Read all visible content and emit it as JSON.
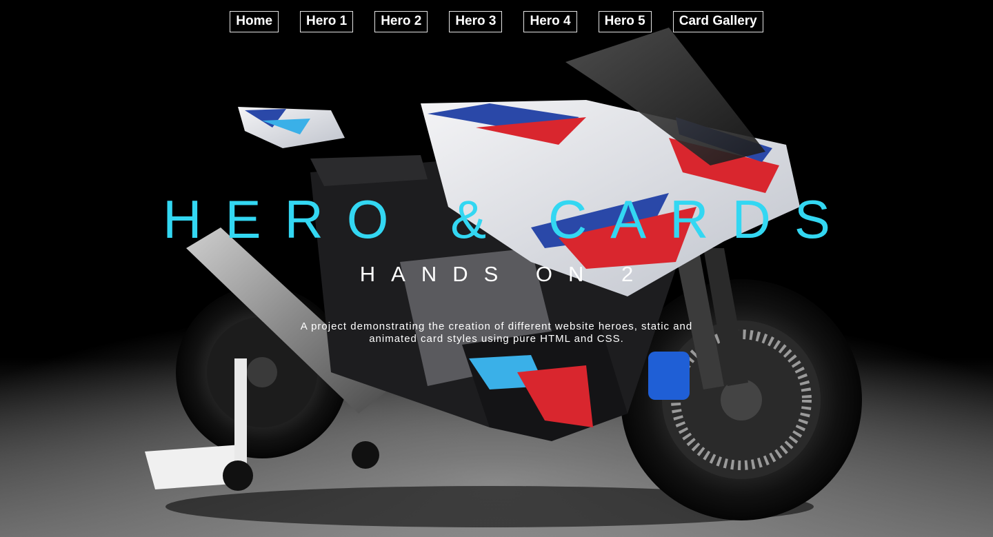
{
  "nav": {
    "items": [
      {
        "label": "Home"
      },
      {
        "label": "Hero 1"
      },
      {
        "label": "Hero 2"
      },
      {
        "label": "Hero 3"
      },
      {
        "label": "Hero 4"
      },
      {
        "label": "Hero 5"
      },
      {
        "label": "Card Gallery"
      }
    ]
  },
  "hero": {
    "title": "HERO & CARDS",
    "subtitle": "HANDS ON 2",
    "description": "A project demonstrating the creation of different website heroes, static and animated card styles using pure HTML and CSS."
  },
  "colors": {
    "title": "#33d7f2",
    "background": "#000000",
    "text": "#ffffff"
  },
  "background_image": {
    "subject": "motorcycle-photo"
  }
}
